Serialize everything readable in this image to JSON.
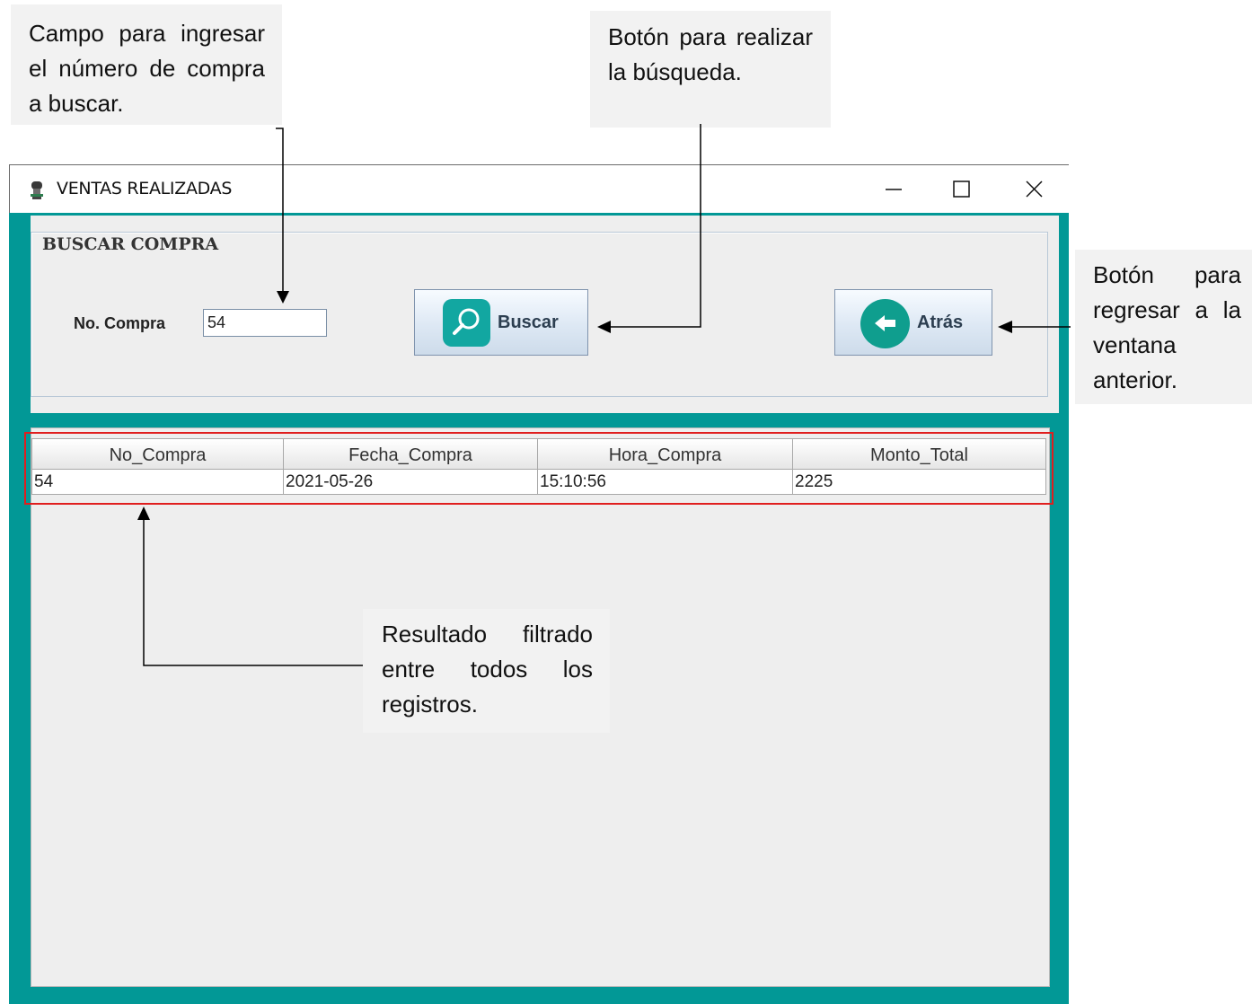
{
  "callouts": {
    "campo": "Campo para ingresar el número de compra a buscar.",
    "boton_buscar": "Botón para realizar la búsqueda.",
    "boton_atras": "Botón para regresar a la ventana anterior.",
    "resultado": "Resultado filtrado entre todos los registros."
  },
  "window": {
    "title": "VENTAS REALIZADAS",
    "icon": "app-icon",
    "controls": {
      "minimize": "—",
      "maximize": "☐",
      "close": "✕"
    }
  },
  "search_panel": {
    "group_title": "BUSCAR COMPRA",
    "label": "No. Compra",
    "input_value": "54",
    "buscar_label": "Buscar",
    "buscar_icon": "search-icon",
    "atras_label": "Atrás",
    "atras_icon": "arrow-left-icon"
  },
  "table": {
    "columns": [
      "No_Compra",
      "Fecha_Compra",
      "Hora_Compra",
      "Monto_Total"
    ],
    "rows": [
      [
        "54",
        "2021-05-26",
        "15:10:56",
        "2225"
      ]
    ]
  },
  "colors": {
    "teal": "#029896",
    "highlight": "#e01e1e",
    "panel": "#eeeeee"
  }
}
